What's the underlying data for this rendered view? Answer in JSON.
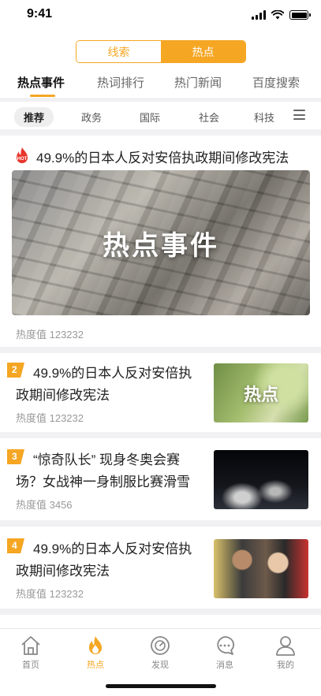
{
  "status_bar": {
    "time": "9:41"
  },
  "segment": {
    "left_label": "线索",
    "right_label": "热点",
    "active": "热点"
  },
  "main_tabs": [
    {
      "label": "热点事件",
      "active": true
    },
    {
      "label": "热词排行",
      "active": false
    },
    {
      "label": "热门新闻",
      "active": false
    },
    {
      "label": "百度搜索",
      "active": false
    }
  ],
  "categories": [
    {
      "label": "推荐",
      "active": true
    },
    {
      "label": "政务",
      "active": false
    },
    {
      "label": "国际",
      "active": false
    },
    {
      "label": "社会",
      "active": false
    },
    {
      "label": "科技",
      "active": false
    }
  ],
  "featured": {
    "badge": "HOT",
    "title": "49.9%的日本人反对安倍执政期间修改宪法",
    "image_text": "热点事件",
    "heat_label": "热度值 123232"
  },
  "news": [
    {
      "rank": "2",
      "title": "49.9%的日本人反对安倍执政期间修改宪法",
      "heat_label": "热度值 123232",
      "thumb_text": "热点"
    },
    {
      "rank": "3",
      "title": "“惊奇队长” 现身冬奥会赛场？女战神一身制服比赛滑雪",
      "heat_label": "热度值 3456",
      "thumb_text": ""
    },
    {
      "rank": "4",
      "title": "49.9%的日本人反对安倍执政期间修改宪法",
      "heat_label": "热度值 123232",
      "thumb_text": ""
    }
  ],
  "bottom_nav": [
    {
      "label": "首页",
      "icon": "home-icon",
      "active": false
    },
    {
      "label": "热点",
      "icon": "flame-icon",
      "active": true
    },
    {
      "label": "发现",
      "icon": "compass-icon",
      "active": false
    },
    {
      "label": "消息",
      "icon": "message-icon",
      "active": false
    },
    {
      "label": "我的",
      "icon": "user-icon",
      "active": false
    }
  ],
  "colors": {
    "accent": "#f5a623",
    "hot_red": "#e8352b",
    "muted": "#999999"
  }
}
